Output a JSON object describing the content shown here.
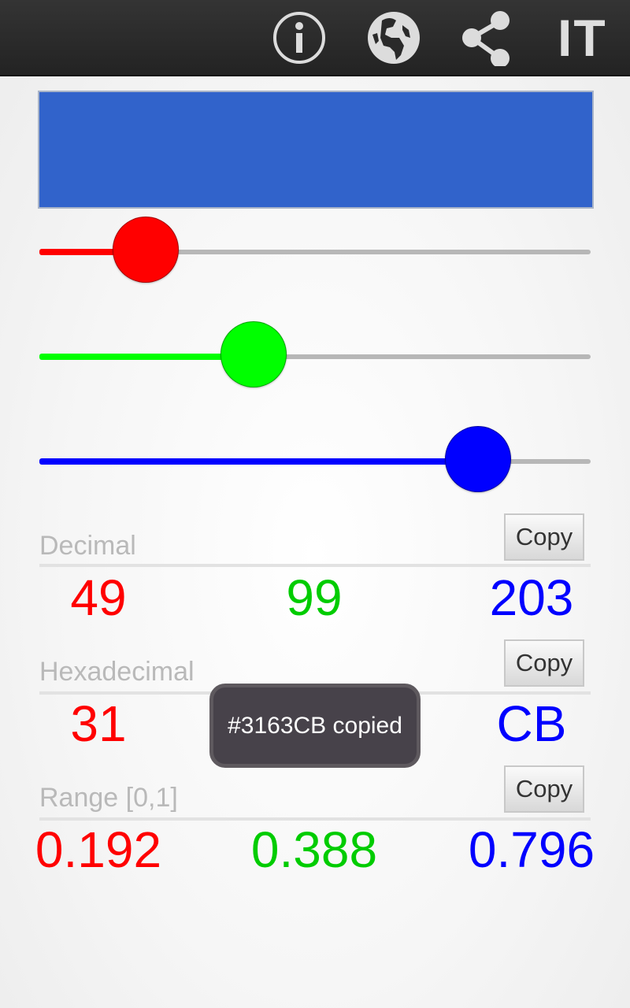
{
  "topbar": {
    "icons": [
      "info-icon",
      "globe-icon",
      "share-icon"
    ],
    "language_label": "IT"
  },
  "color": {
    "hex": "#3163CB",
    "r": 49,
    "g": 99,
    "b": 203,
    "max": 255
  },
  "slider_colors": {
    "red": "#ff0000",
    "green": "#00ff00",
    "blue": "#0000ff"
  },
  "sections": {
    "decimal": {
      "label": "Decimal",
      "copy": "Copy",
      "r": "49",
      "g": "99",
      "b": "203"
    },
    "hex": {
      "label": "Hexadecimal",
      "copy": "Copy",
      "r": "31",
      "b": "CB"
    },
    "range": {
      "label": "Range [0,1]",
      "copy": "Copy",
      "r": "0.192",
      "g": "0.388",
      "b": "0.796"
    }
  },
  "value_colors": {
    "r": "#ff0000",
    "g": "#00cc00",
    "b": "#0000ff"
  },
  "toast": "#3163CB copied"
}
